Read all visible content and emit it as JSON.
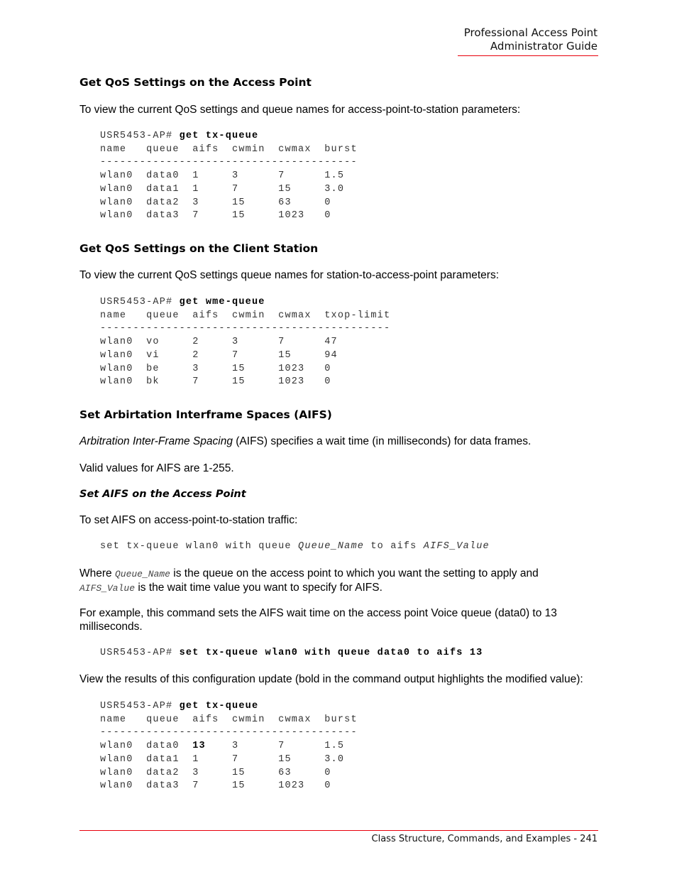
{
  "header": {
    "line1": "Professional Access Point",
    "line2": "Administrator Guide"
  },
  "sections": {
    "ap_title": "Get QoS Settings on the Access Point",
    "ap_intro": "To view the current QoS settings and queue names for access-point-to-station parameters:",
    "client_title": "Get QoS Settings on the Client Station",
    "client_intro": "To view the current QoS settings queue names for station-to-access-point parameters:",
    "aifs_title": "Set Arbirtation Interframe Spaces (AIFS)",
    "aifs_desc_italic": "Arbitration Inter-Frame Spacing",
    "aifs_desc_rest": " (AIFS) specifies a wait time (in milliseconds) for data frames.",
    "aifs_valid": "Valid values for AIFS are 1-255.",
    "aifs_sub_title": "Set AIFS on the Access Point",
    "aifs_sub_intro": "To set AIFS on access-point-to-station traffic:",
    "syntax_plain1": "set tx-queue wlan0 with queue ",
    "syntax_var1": "Queue_Name",
    "syntax_plain2": " to aifs ",
    "syntax_var2": "AIFS_Value",
    "where_1": "Where ",
    "where_var1": "Queue_Name",
    "where_2": " is the queue on the access point to which you want the setting to apply and",
    "where_var2": "AIFS_Value",
    "where_3": " is the wait time value you want to specify for AIFS.",
    "example_text": "For example, this command sets the AIFS wait time on the access point Voice queue (data0) to 13 milliseconds.",
    "results_text": "View the results of this configuration update (bold in the command output highlights the modified value):"
  },
  "code_blocks": [
    {
      "prompt": "USR5453-AP# ",
      "command": "get tx-queue",
      "columns": [
        "name",
        "queue",
        "aifs",
        "cwmin",
        "cwmax",
        "burst"
      ],
      "separator": "---------------------------------------",
      "rows": [
        [
          "wlan0",
          "data0",
          "1",
          "3",
          "7",
          "1.5"
        ],
        [
          "wlan0",
          "data1",
          "1",
          "7",
          "15",
          "3.0"
        ],
        [
          "wlan0",
          "data2",
          "3",
          "15",
          "63",
          "0"
        ],
        [
          "wlan0",
          "data3",
          "7",
          "15",
          "1023",
          "0"
        ]
      ],
      "bold_cells": []
    },
    {
      "prompt": "USR5453-AP# ",
      "command": "get wme-queue",
      "columns": [
        "name",
        "queue",
        "aifs",
        "cwmin",
        "cwmax",
        "txop-limit"
      ],
      "separator": "--------------------------------------------",
      "rows": [
        [
          "wlan0",
          "vo",
          "2",
          "3",
          "7",
          "47"
        ],
        [
          "wlan0",
          "vi",
          "2",
          "7",
          "15",
          "94"
        ],
        [
          "wlan0",
          "be",
          "3",
          "15",
          "1023",
          "0"
        ],
        [
          "wlan0",
          "bk",
          "7",
          "15",
          "1023",
          "0"
        ]
      ],
      "bold_cells": []
    },
    {
      "prompt": "USR5453-AP# ",
      "command": "set tx-queue wlan0 with queue data0 to aifs 13"
    },
    {
      "prompt": "USR5453-AP# ",
      "command": "get tx-queue",
      "columns": [
        "name",
        "queue",
        "aifs",
        "cwmin",
        "cwmax",
        "burst"
      ],
      "separator": "---------------------------------------",
      "rows": [
        [
          "wlan0",
          "data0",
          "13",
          "3",
          "7",
          "1.5"
        ],
        [
          "wlan0",
          "data1",
          "1",
          "7",
          "15",
          "3.0"
        ],
        [
          "wlan0",
          "data2",
          "3",
          "15",
          "63",
          "0"
        ],
        [
          "wlan0",
          "data3",
          "7",
          "15",
          "1023",
          "0"
        ]
      ],
      "bold_cells": [
        [
          0,
          2
        ]
      ]
    }
  ],
  "footer": {
    "text": "Class Structure, Commands, and Examples - 241"
  },
  "colors": {
    "rule": "#e8000b"
  }
}
